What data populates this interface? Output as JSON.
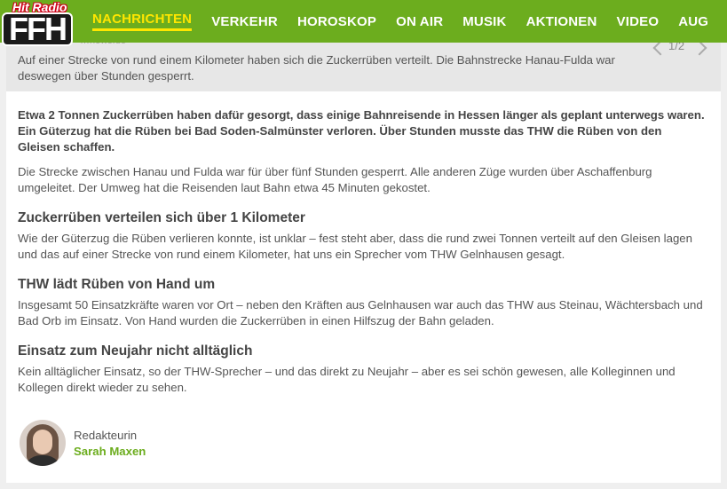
{
  "brand": {
    "logo_top": "Hit Radio",
    "logo_main": "FFH"
  },
  "nav": {
    "items": [
      "NACHRICHTEN",
      "VERKEHR",
      "HOROSKOP",
      "ON AIR",
      "MUSIK",
      "AKTIONEN",
      "VIDEO",
      "AUG"
    ],
    "active": "NACHRICHTEN"
  },
  "gallery": {
    "credit": "…news.de",
    "caption": "Auf einer Strecke von rund einem Kilometer haben sich die Zuckerrüben verteilt. Die Bahnstrecke Hanau-Fulda war deswegen über Stunden gesperrt.",
    "pager": "1/2"
  },
  "article": {
    "lead": "Etwa 2 Tonnen Zuckerrüben haben dafür gesorgt, dass einige Bahnreisende in Hessen länger als geplant unterwegs waren. Ein Güterzug hat die Rüben bei Bad Soden-Salmünster verloren. Über Stunden musste das THW die Rüben von den Gleisen schaffen.",
    "p1": "Die Strecke zwischen Hanau und Fulda war für über fünf Stunden gesperrt. Alle anderen Züge wurden über Aschaffenburg umgeleitet. Der Umweg hat die Reisenden laut Bahn etwa 45 Minuten gekostet.",
    "h1": "Zuckerrüben verteilen sich über 1 Kilometer",
    "p2": "Wie der Güterzug die Rüben verlieren konnte, ist unklar – fest steht aber, dass die rund zwei Tonnen verteilt auf den Gleisen lagen und das auf einer Strecke von rund einem Kilometer, hat uns ein Sprecher vom THW Gelnhausen gesagt.",
    "h2": "THW lädt Rüben von Hand um",
    "p3": "Insgesamt 50 Einsatzkräfte waren vor Ort – neben den Kräften aus Gelnhausen war auch das THW aus Steinau, Wächtersbach und Bad Orb im Einsatz. Von Hand wurden die Zuckerrüben in einen Hilfszug der Bahn geladen.",
    "h3": "Einsatz zum Neujahr nicht alltäglich",
    "p4": "Kein alltäglicher Einsatz, so der THW-Sprecher – und das direkt zu Neujahr – aber es sei schön gewesen, alle Kolleginnen und Kollegen direkt wieder zu sehen."
  },
  "author": {
    "role": "Redakteurin",
    "name": "Sarah Maxen"
  },
  "colors": {
    "brand_green": "#6cad1e",
    "active_yellow": "#ffe600"
  }
}
